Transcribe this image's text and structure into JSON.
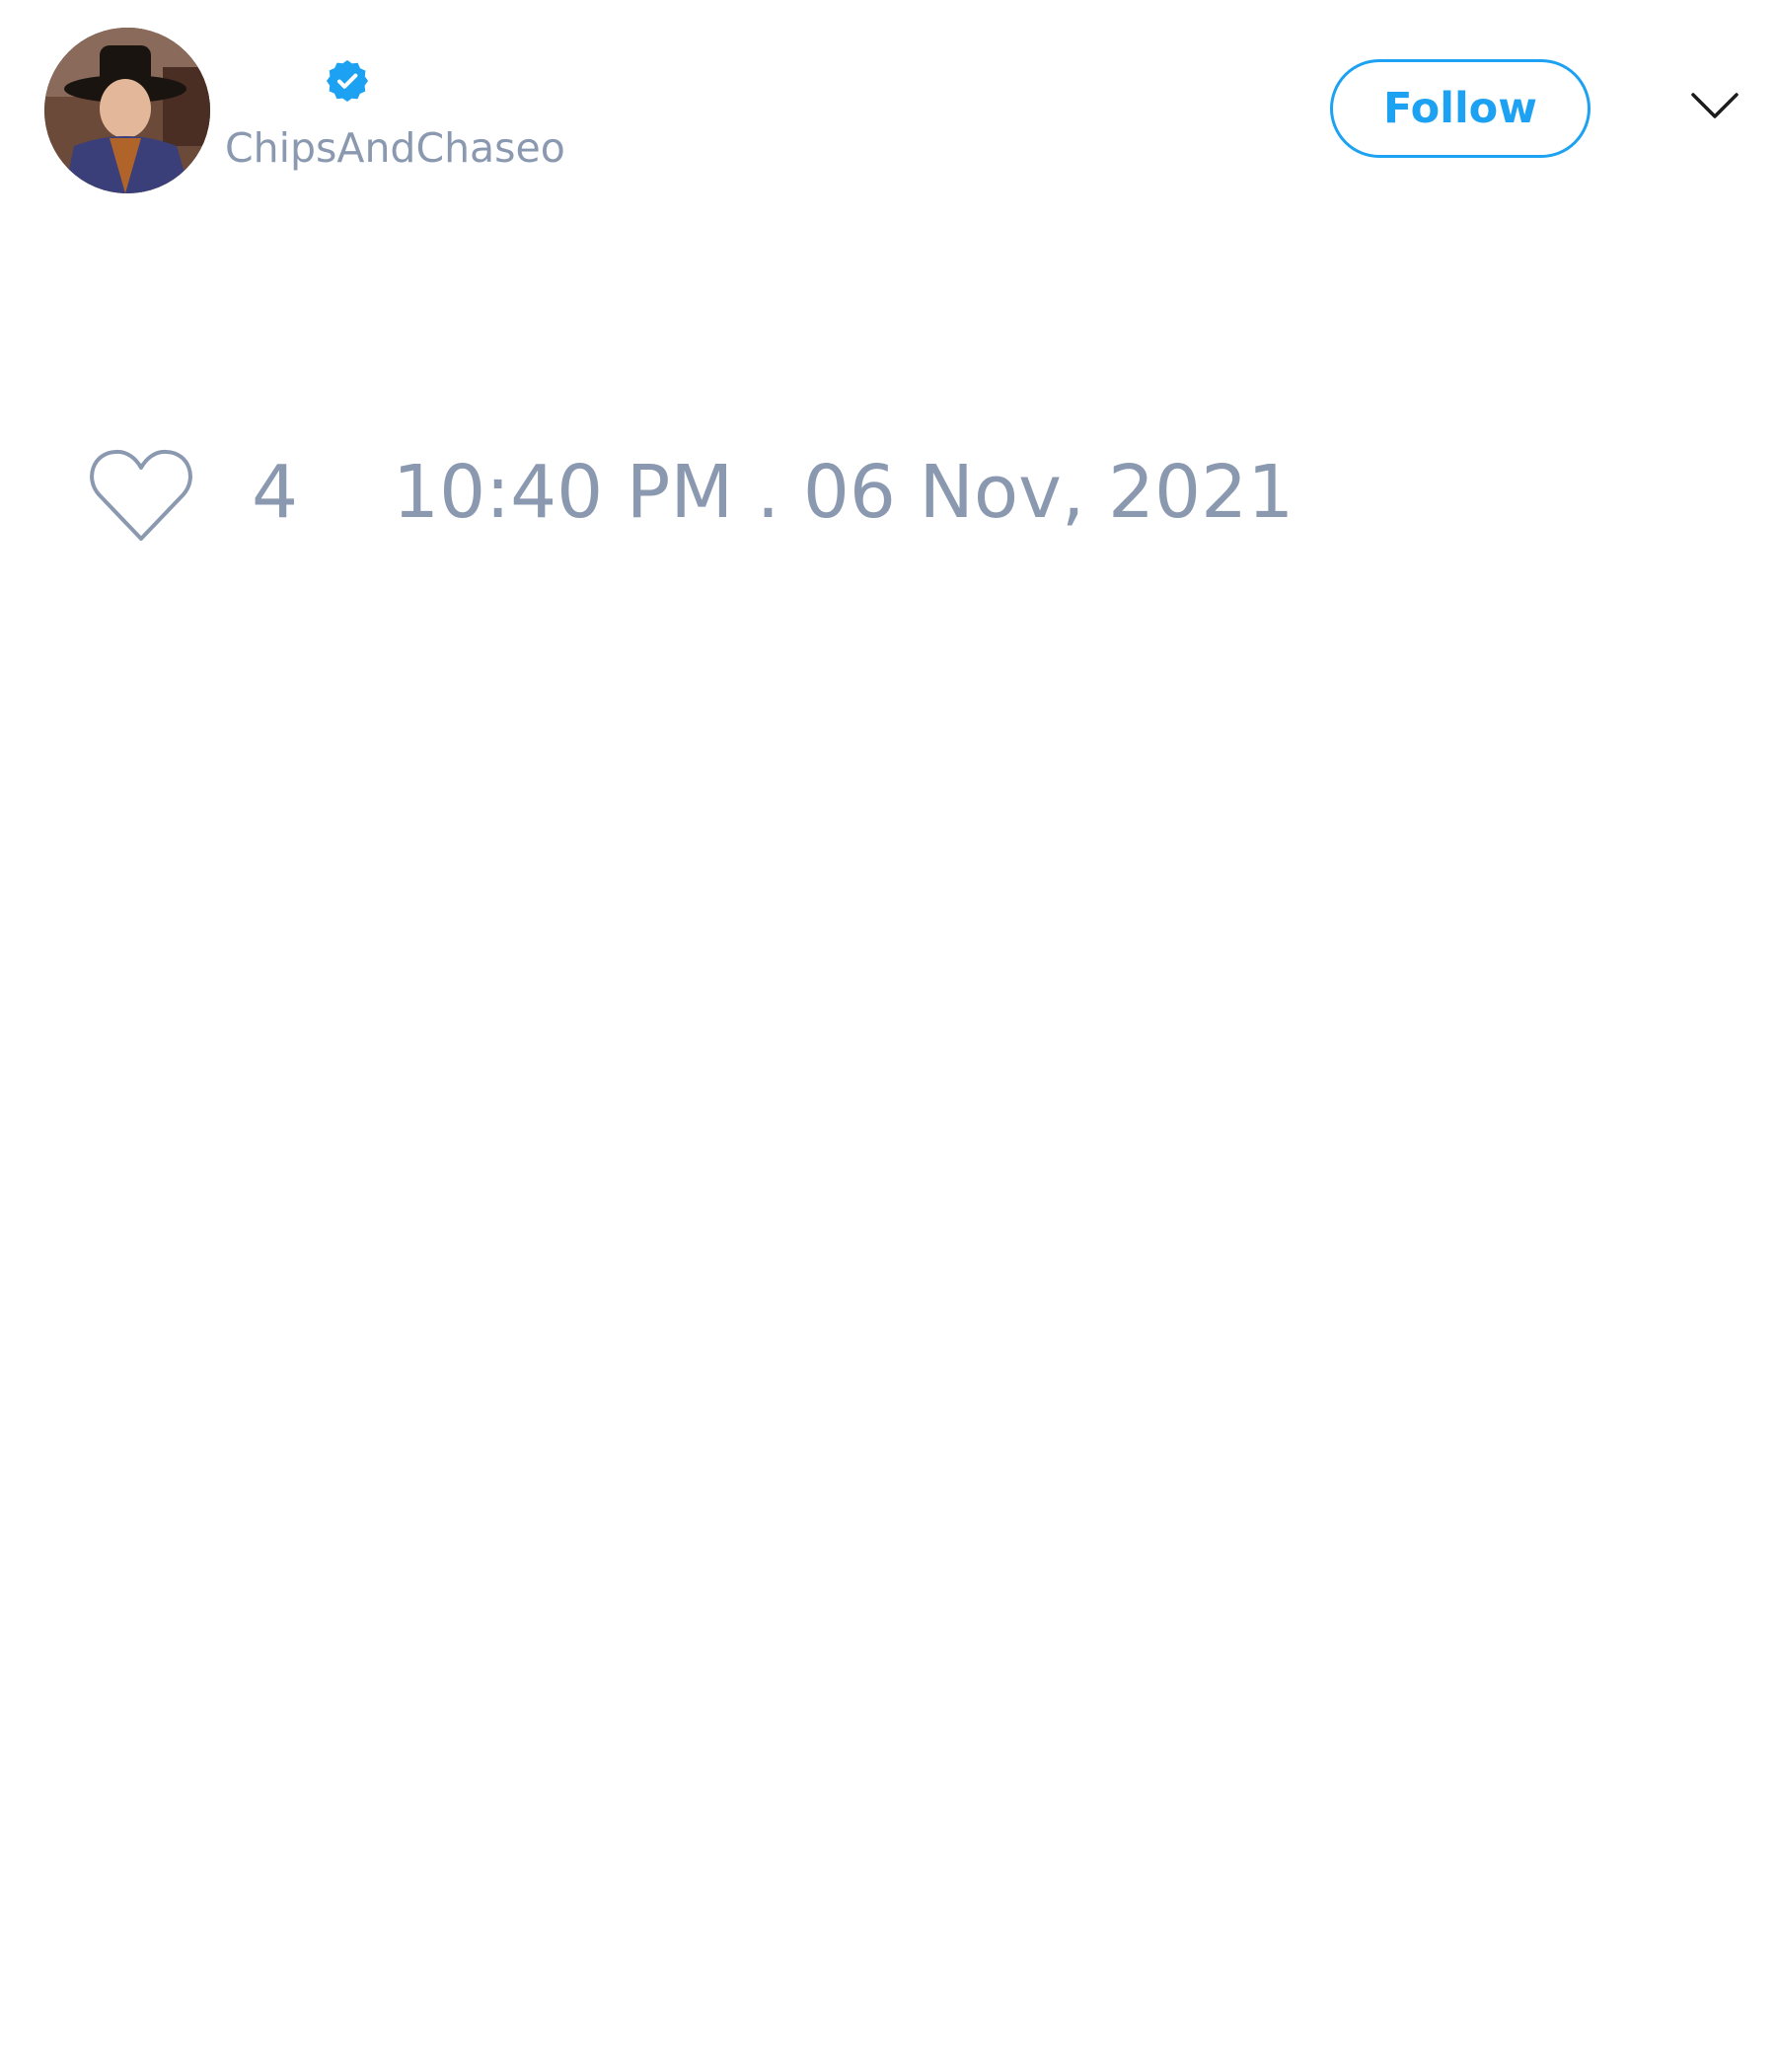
{
  "tweet": {
    "author": {
      "handle": "ChipsAndChaseo",
      "verified": true,
      "avatar": "profile-photo"
    },
    "follow_label": "Follow",
    "menu_icon": "chevron-down-icon",
    "likes": {
      "icon": "heart-icon",
      "count": "4"
    },
    "timestamp": "10:40 PM . 06 Nov, 2021"
  },
  "colors": {
    "accent": "#1da1f2",
    "muted_text": "#8b99b0",
    "background": "#ffffff"
  }
}
